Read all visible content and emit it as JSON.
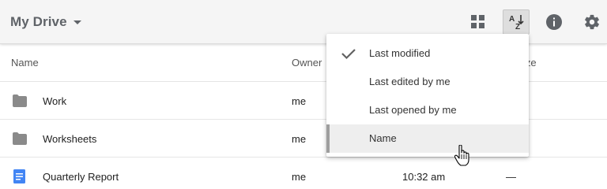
{
  "toolbar": {
    "title": "My Drive",
    "icons": [
      "grid-view-icon",
      "sort-az-icon",
      "info-icon",
      "gear-icon"
    ]
  },
  "columns": {
    "name": "Name",
    "owner": "Owner",
    "size_partial": "ize"
  },
  "rows": [
    {
      "name": "Work",
      "owner": "me",
      "modified": "",
      "size": "",
      "icon": "folder-icon"
    },
    {
      "name": "Worksheets",
      "owner": "me",
      "modified": "",
      "size": "",
      "icon": "folder-icon"
    },
    {
      "name": "Quarterly Report",
      "owner": "me",
      "modified": "10:32 am",
      "size": "—",
      "icon": "docs-icon"
    }
  ],
  "sort_menu": {
    "items": [
      {
        "label": "Last modified",
        "checked": true
      },
      {
        "label": "Last edited by me",
        "checked": false
      },
      {
        "label": "Last opened by me",
        "checked": false
      },
      {
        "label": "Name",
        "checked": false,
        "hovered": true
      }
    ]
  },
  "colors": {
    "toolbar_bg": "#f5f5f5",
    "icon_gray": "#5f6368",
    "docs_blue": "#4285f4",
    "folder_gray": "#8a8a8a"
  }
}
